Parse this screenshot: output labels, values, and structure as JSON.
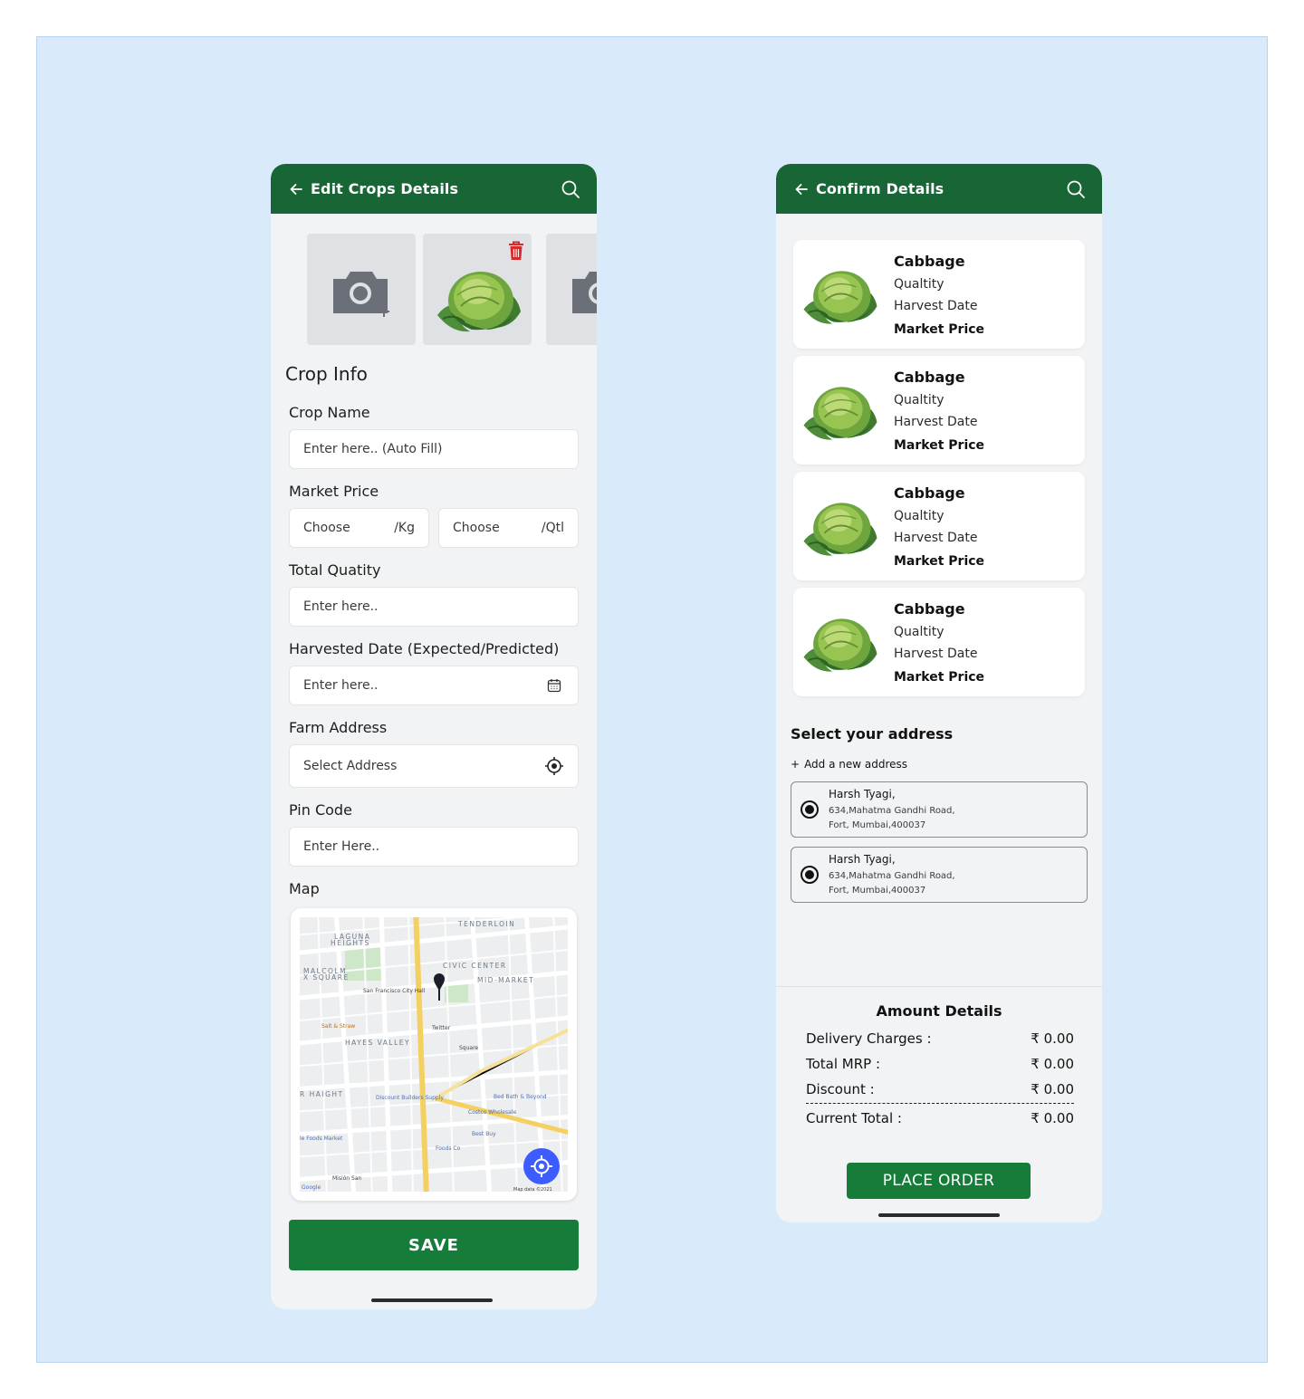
{
  "left_screen": {
    "title": "Edit Crops Details",
    "back_icon": "arrow-left-icon",
    "search_icon": "search-icon",
    "section_title": "Crop Info",
    "crop_name": {
      "label": "Crop Name",
      "placeholder": "Enter here.. (Auto Fill)"
    },
    "market_price": {
      "label": "Market Price",
      "per_kg": {
        "placeholder": "Choose",
        "unit": "/Kg"
      },
      "per_qtl": {
        "placeholder": "Choose",
        "unit": "/Qtl"
      }
    },
    "total_quantity": {
      "label": "Total Quatity",
      "placeholder": "Enter here.."
    },
    "harvest_date": {
      "label": "Harvested Date (Expected/Predicted)",
      "placeholder": "Enter here.."
    },
    "farm_address": {
      "label": "Farm Address",
      "placeholder": "Select Address"
    },
    "pin_code": {
      "label": "Pin Code",
      "placeholder": "Enter Here.."
    },
    "map": {
      "label": "Map"
    },
    "save_label": "SAVE"
  },
  "right_screen": {
    "title": "Confirm Details",
    "back_icon": "arrow-left-icon",
    "search_icon": "search-icon",
    "crops": [
      {
        "name": "Cabbage",
        "quality": "Qualtity",
        "harvest": "Harvest Date",
        "price": "Market Price"
      },
      {
        "name": "Cabbage",
        "quality": "Qualtity",
        "harvest": "Harvest Date",
        "price": "Market Price"
      },
      {
        "name": "Cabbage",
        "quality": "Qualtity",
        "harvest": "Harvest Date",
        "price": "Market Price"
      },
      {
        "name": "Cabbage",
        "quality": "Qualtity",
        "harvest": "Harvest Date",
        "price": "Market Price"
      }
    ],
    "address_title": "Select your address",
    "add_address": "Add a new address",
    "addresses": [
      {
        "name": "Harsh Tyagi,",
        "line1": "634,Mahatma Gandhi Road,",
        "line2": "Fort, Mumbai,400037"
      },
      {
        "name": "Harsh Tyagi,",
        "line1": "634,Mahatma Gandhi Road,",
        "line2": "Fort, Mumbai,400037"
      }
    ],
    "amount": {
      "title": "Amount Details",
      "rows": [
        {
          "label": "Delivery Charges :",
          "value": "₹ 0.00"
        },
        {
          "label": "Total MRP :",
          "value": "₹ 0.00"
        },
        {
          "label": "Discount :",
          "value": "₹ 0.00"
        },
        {
          "label": "Current Total :",
          "value": "₹ 0.00"
        }
      ]
    },
    "place_order_label": "PLACE ORDER"
  },
  "colors": {
    "brand_green": "#186536",
    "button_green": "#167c3a",
    "canvas_blue": "#d9eafa",
    "delete_red": "#d62b2b",
    "locate_blue": "#3d5cff"
  }
}
